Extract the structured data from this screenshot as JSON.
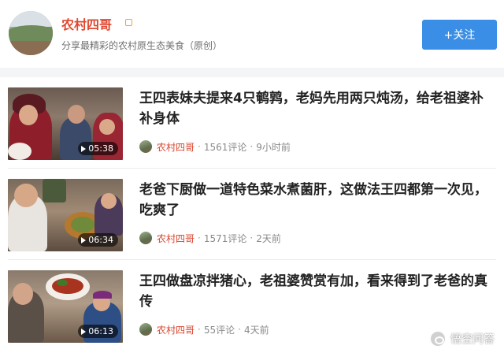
{
  "channel": {
    "name": "农村四哥",
    "description": "分享最精彩的农村原生态美食（原创）",
    "follow_label": "+关注"
  },
  "articles": [
    {
      "title": "王四表妹夫提来4只鹌鹑，老妈先用两只炖汤，给老祖婆补补身体",
      "author": "农村四哥",
      "comments": "1561评论",
      "time": "9小时前",
      "duration": "05:38"
    },
    {
      "title": "老爸下厨做一道特色菜水煮菌肝，这做法王四都第一次见，吃爽了",
      "author": "农村四哥",
      "comments": "1571评论",
      "time": "2天前",
      "duration": "06:34"
    },
    {
      "title": "王四做盘凉拌猪心，老祖婆赞赏有加，看来得到了老爸的真传",
      "author": "农村四哥",
      "comments": "55评论",
      "time": "4天前",
      "duration": "06:13"
    }
  ],
  "watermark": "悟空问答",
  "colors": {
    "accent_red": "#e0472f",
    "follow_blue": "#3a8ee6"
  }
}
